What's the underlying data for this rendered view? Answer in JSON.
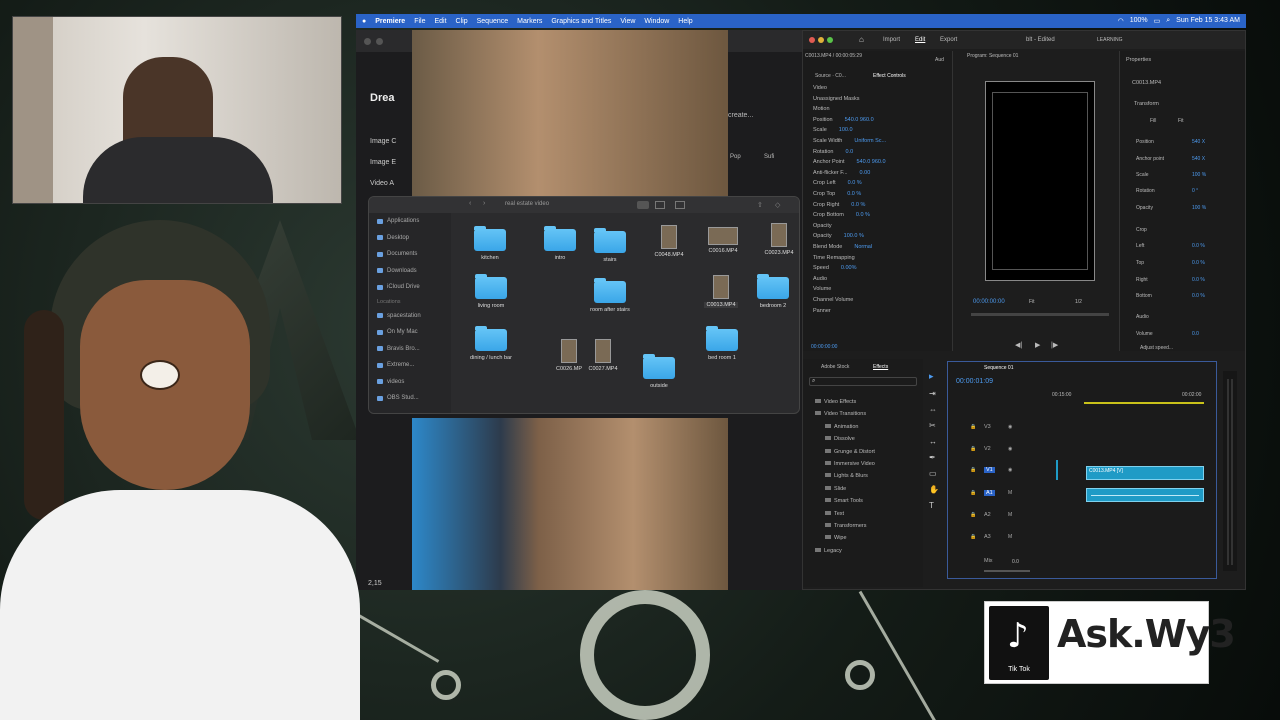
{
  "menubar": {
    "app": "Premiere",
    "items": [
      "File",
      "Edit",
      "Clip",
      "Sequence",
      "Markers",
      "Graphics and Titles",
      "View",
      "Window",
      "Help"
    ],
    "battery": "100%",
    "clock": "Sun Feb 15  3:43 AM"
  },
  "browser": {
    "app_name": "Drea",
    "sidebar": [
      "Image C",
      "Image E",
      "Video A"
    ],
    "create_text": "create...",
    "chips": [
      "Pop",
      "Sufi"
    ],
    "bottom_count": "2,15"
  },
  "finder": {
    "path": "real estate video",
    "sidebar_favorites": [
      "Applications",
      "Desktop",
      "Documents",
      "Downloads",
      "iCloud Drive"
    ],
    "locations_header": "Locations",
    "sidebar_locations": [
      "spacestation",
      "On My Mac",
      "Bravis Bro...",
      "Extreme...",
      "videos",
      "OBS Stud..."
    ],
    "items": {
      "kitchen": "kitchen",
      "intro": "intro",
      "stairs": "stairs",
      "c0048": "C0048.MP4",
      "c0016": "C0016.MP4",
      "c0023": "C0023.MP4",
      "living": "living room",
      "room_after": "room after stairs",
      "c0013": "C0013.MP4",
      "bedroom2": "bedroom 2",
      "dining": "dining / lunch bar",
      "c0026": "C0026.MP",
      "c0027": "C0027.MP4",
      "bedroom1": "bed room 1",
      "outside": "outside"
    }
  },
  "premiere": {
    "header_tabs": [
      "Import",
      "Edit",
      "Export"
    ],
    "project_title": "blt - Edited",
    "learning": "LEARNING",
    "ec_tabs": [
      "Source · C0...",
      "Effect Controls",
      "Aud"
    ],
    "ec_clip": "C0013.MP4 / 00:00:05:29",
    "program_label": "Program: Sequence 01",
    "ec_rows": [
      {
        "name": "Video",
        "value": ""
      },
      {
        "name": "Unassigned Masks",
        "value": ""
      },
      {
        "name": "Motion",
        "value": ""
      },
      {
        "name": "Position",
        "value": "540.0   960.0"
      },
      {
        "name": "Scale",
        "value": "100.0"
      },
      {
        "name": "Scale Width",
        "value": "Uniform Sc..."
      },
      {
        "name": "Rotation",
        "value": "0.0"
      },
      {
        "name": "Anchor Point",
        "value": "540.0   960.0"
      },
      {
        "name": "Anti-flicker F...",
        "value": "0.00"
      },
      {
        "name": "Crop Left",
        "value": "0.0 %"
      },
      {
        "name": "Crop Top",
        "value": "0.0 %"
      },
      {
        "name": "Crop Right",
        "value": "0.0 %"
      },
      {
        "name": "Crop Bottom",
        "value": "0.0 %"
      },
      {
        "name": "Opacity",
        "value": ""
      },
      {
        "name": "Opacity",
        "value": "100.0 %"
      },
      {
        "name": "Blend Mode",
        "value": "Normal"
      },
      {
        "name": "Time Remapping",
        "value": ""
      },
      {
        "name": "Speed",
        "value": "0.00%"
      },
      {
        "name": "Audio",
        "value": ""
      },
      {
        "name": "Volume",
        "value": ""
      },
      {
        "name": "Channel Volume",
        "value": ""
      },
      {
        "name": "Panner",
        "value": ""
      }
    ],
    "ec_timecode": "00:00:00:00",
    "program_timecode": "00:00:00:00",
    "fit": "Fit",
    "res": "1/2",
    "properties": {
      "title": "Properties",
      "clip": "C0013.MP4",
      "transform": "Transform",
      "fill": "Fill",
      "fit": "Fit",
      "position": "Position",
      "position_v": "540 X",
      "anchor": "Anchor point",
      "anchor_v": "540 X",
      "scale": "Scale",
      "scale_v": "100 %",
      "rotation": "Rotation",
      "rotation_v": "0 °",
      "opacity": "Opacity",
      "opacity_v": "100 %",
      "crop": "Crop",
      "left": "Left",
      "left_v": "0.0 %",
      "top": "Top",
      "top_v": "0.0 %",
      "right": "Right",
      "right_v": "0.0 %",
      "bottom": "Bottom",
      "bottom_v": "0.0 %",
      "audio": "Audio",
      "volume": "Volume",
      "volume_v": "0.0",
      "adjust_speed": "Adjust speed..."
    },
    "effects_tabs": [
      "Adobe Stock",
      "Effects"
    ],
    "effects_list": [
      "Video Effects",
      "Video Transitions",
      "Animation",
      "Dissolve",
      "Grunge & Distort",
      "Immersive Video",
      "Lights & Blurs",
      "Slide",
      "Smart Tools",
      "Text",
      "Transformers",
      "Wipe",
      "Legacy"
    ],
    "sequence_tab": "Sequence 01",
    "seq_timecode": "00:00:01:09",
    "ruler": [
      "00:15:00",
      "00:02:00"
    ],
    "tracks": [
      "V3",
      "V2",
      "V1",
      "A1",
      "A2",
      "A3",
      "Mix"
    ],
    "clip_label": "C0013.MP4 [V]",
    "mix_val": "0.0"
  },
  "tiktok": {
    "handle": "Ask.Wy3",
    "caption": "Tik Tok"
  },
  "colors": {
    "accent": "#2a63c7",
    "clip": "#1f9bc6",
    "timecode": "#4d9bf0"
  }
}
